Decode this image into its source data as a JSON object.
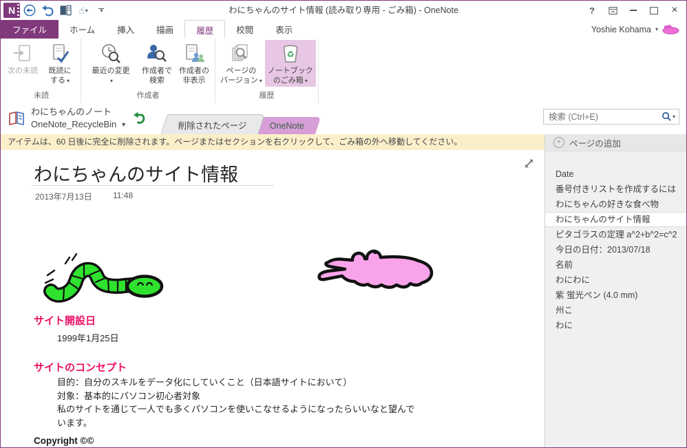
{
  "titlebar": {
    "title": "わにちゃんのサイト情報 (読み取り専用 - ごみ箱) - OneNote",
    "help_glyph": "?"
  },
  "account": {
    "name": "Yoshie Kohama"
  },
  "tabs": {
    "file": "ファイル",
    "items": [
      "ホーム",
      "挿入",
      "描画",
      "履歴",
      "校閲",
      "表示"
    ]
  },
  "ribbon": {
    "groups": [
      {
        "label": "未読",
        "buttons": [
          {
            "line1": "次の未読",
            "line2": ""
          },
          {
            "line1": "既読に",
            "line2": "する"
          }
        ]
      },
      {
        "label": "作成者",
        "buttons": [
          {
            "line1": "最近の変更",
            "line2": ""
          },
          {
            "line1": "作成者で",
            "line2": "検索"
          },
          {
            "line1": "作成者の",
            "line2": "非表示"
          }
        ]
      },
      {
        "label": "履歴",
        "buttons": [
          {
            "line1": "ページの",
            "line2": "バージョン"
          },
          {
            "line1": "ノートブック",
            "line2": "のごみ箱"
          }
        ]
      }
    ]
  },
  "nav": {
    "notebook_title": "わにちゃんのノート",
    "notebook_subtitle": "OneNote_RecycleBin",
    "section_tabs": [
      {
        "label": "削除されたページ"
      },
      {
        "label": "OneNote"
      }
    ],
    "search_placeholder": "検索 (Ctrl+E)"
  },
  "notice": {
    "text": "アイテムは、60 日後に完全に削除されます。ページまたはセクションを右クリックして、ごみ箱の外へ移動してください。"
  },
  "page": {
    "title": "わにちゃんのサイト情報",
    "date": "2013年7月13日",
    "time": "11:48",
    "sections": [
      {
        "heading": "サイト開設日",
        "lines": [
          "1999年1月25日"
        ]
      },
      {
        "heading": "サイトのコンセプト",
        "lines": [
          "目的：自分のスキルをデータ化にしていくこと（日本語サイトにおいて）",
          "対象：基本的にパソコン初心者対象",
          "私のサイトを通じて一人でも多くパソコンを使いこなせるようになったらいいなと望んで",
          "います。"
        ]
      }
    ],
    "footer": "Copyright ©©"
  },
  "sidebar": {
    "add_page_label": "ページの追加",
    "items": [
      "Date",
      "番号付きリストを作成するには",
      "わにちゃんの好きな食べ物",
      "わにちゃんのサイト情報",
      "ピタゴラスの定理  a^2+b^2=c^2",
      "今日の日付：2013/07/18",
      "名前",
      "わにわに",
      "紫 蛍光ペン (4.0 mm)",
      "州こ",
      "わに"
    ]
  },
  "glyphs": {
    "dropdown": "▾",
    "section_dropdown": "▼",
    "plus": "+"
  },
  "colors": {
    "accent": "#80397b",
    "section_tab_pink": "#d79ed7",
    "heading_pink": "#ee1166",
    "notice_bg": "#fbefca",
    "highlight_button_bg": "#e7c7e3",
    "caterpillar_green": "#2ee22e",
    "crocodile_pink": "#f9a3ea"
  }
}
